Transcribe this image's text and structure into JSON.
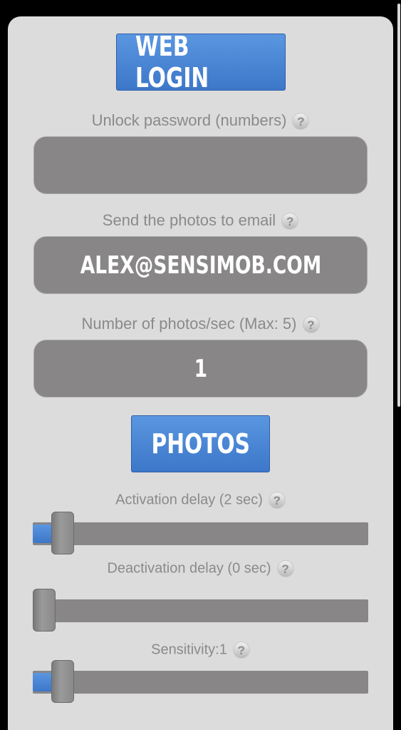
{
  "web_login_button": "WEB LOGIN",
  "unlock_password": {
    "label": "Unlock password (numbers)",
    "value": ""
  },
  "email": {
    "label": "Send the photos to email",
    "value": "ALEX@SENSIMOB.COM"
  },
  "photos_per_sec": {
    "label": "Number of photos/sec (Max: 5)",
    "value": "1"
  },
  "photos_button": "PHOTOS",
  "activation_delay": {
    "label": "Activation delay (2 sec)",
    "level": 0.06
  },
  "deactivation_delay": {
    "label": "Deactivation delay (0 sec)",
    "level": 0.0
  },
  "sensitivity": {
    "label": "Sensitivity:1",
    "level": 0.06
  },
  "help_glyph": "?",
  "colors": {
    "accent": "#4a86d6",
    "panel": "#dcdcdc",
    "field": "#888687"
  }
}
